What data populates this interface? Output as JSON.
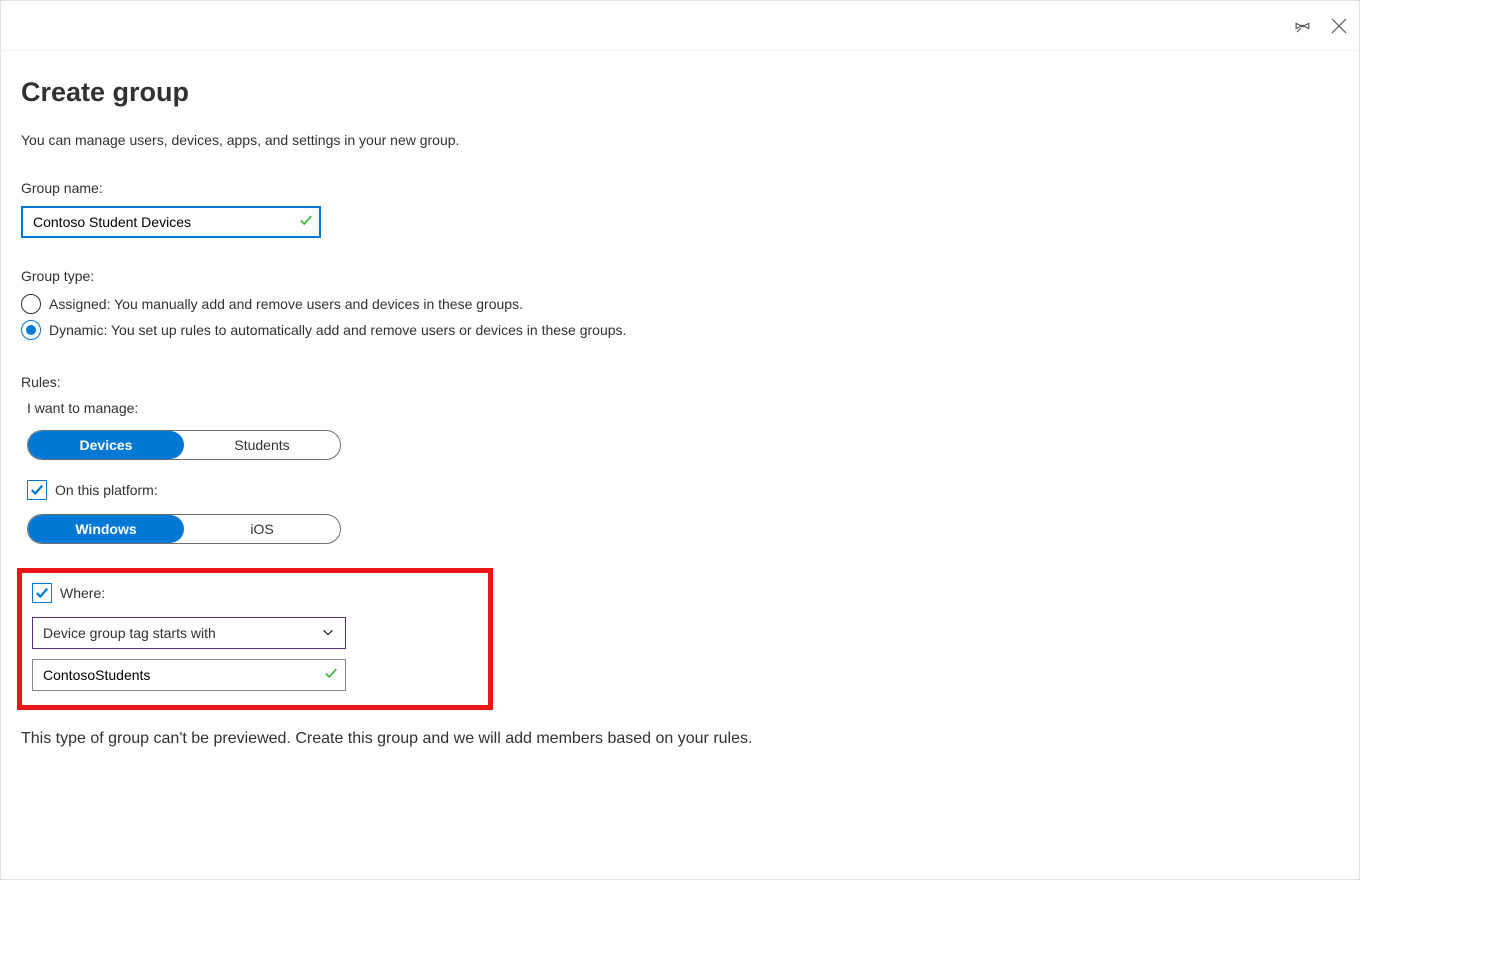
{
  "title": "Create group",
  "subtitle": "You can manage users, devices, apps, and settings in your new group.",
  "groupName": {
    "label": "Group name:",
    "value": "Contoso Student Devices"
  },
  "groupType": {
    "label": "Group type:",
    "options": {
      "assigned": "Assigned: You manually add and remove users and devices in these groups.",
      "dynamic": "Dynamic: You set up rules to automatically add and remove users or devices in these groups."
    },
    "selected": "dynamic"
  },
  "rules": {
    "label": "Rules:",
    "manageLabel": "I want to manage:",
    "manageOptions": {
      "devices": "Devices",
      "students": "Students"
    },
    "platform": {
      "checkboxLabel": "On this platform:",
      "options": {
        "windows": "Windows",
        "ios": "iOS"
      }
    },
    "where": {
      "checkboxLabel": "Where:",
      "condition": "Device group tag starts with",
      "value": "ContosoStudents"
    }
  },
  "footer": "This type of group can't be previewed. Create this group and we will add members based on your rules."
}
